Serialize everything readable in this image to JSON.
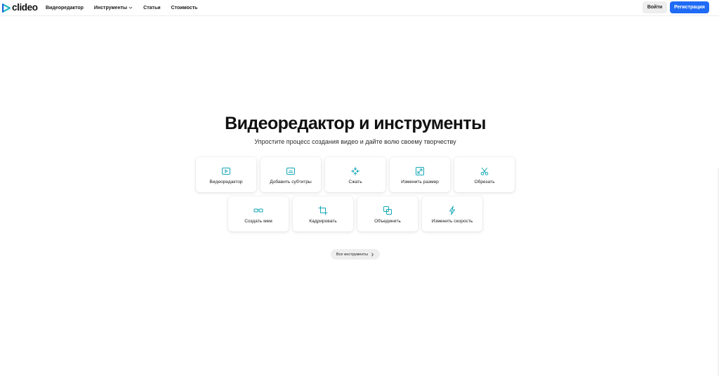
{
  "header": {
    "logo_text": "clideo",
    "nav": [
      {
        "label": "Видеоредактор",
        "has_dropdown": false
      },
      {
        "label": "Инструменты",
        "has_dropdown": true
      },
      {
        "label": "Статьи",
        "has_dropdown": false
      },
      {
        "label": "Стоимость",
        "has_dropdown": false
      }
    ],
    "login_label": "Войти",
    "register_label": "Регистрация"
  },
  "hero": {
    "title": "Видеоредактор и инструменты",
    "subtitle": "Упростите процесс создания видео и дайте волю своему творчеству"
  },
  "tools": {
    "row1": [
      {
        "label": "Видеоредактор",
        "icon": "play-window-icon"
      },
      {
        "label": "Добавить субтитры",
        "icon": "subtitles-icon"
      },
      {
        "label": "Сжать",
        "icon": "compress-icon"
      },
      {
        "label": "Изменить размер",
        "icon": "resize-icon"
      },
      {
        "label": "Обрезать",
        "icon": "scissors-icon"
      }
    ],
    "row2": [
      {
        "label": "Создать мем",
        "icon": "meme-glasses-icon"
      },
      {
        "label": "Кадрировать",
        "icon": "crop-icon"
      },
      {
        "label": "Объединить",
        "icon": "merge-icon"
      },
      {
        "label": "Изменить скорость",
        "icon": "lightning-icon"
      }
    ]
  },
  "all_tools_label": "Все инструменты",
  "colors": {
    "accent_teal": "#14a6b5",
    "brand_blue": "#1f6bf5",
    "logo_teal": "#1fb6c3",
    "text_dark": "#111111"
  }
}
